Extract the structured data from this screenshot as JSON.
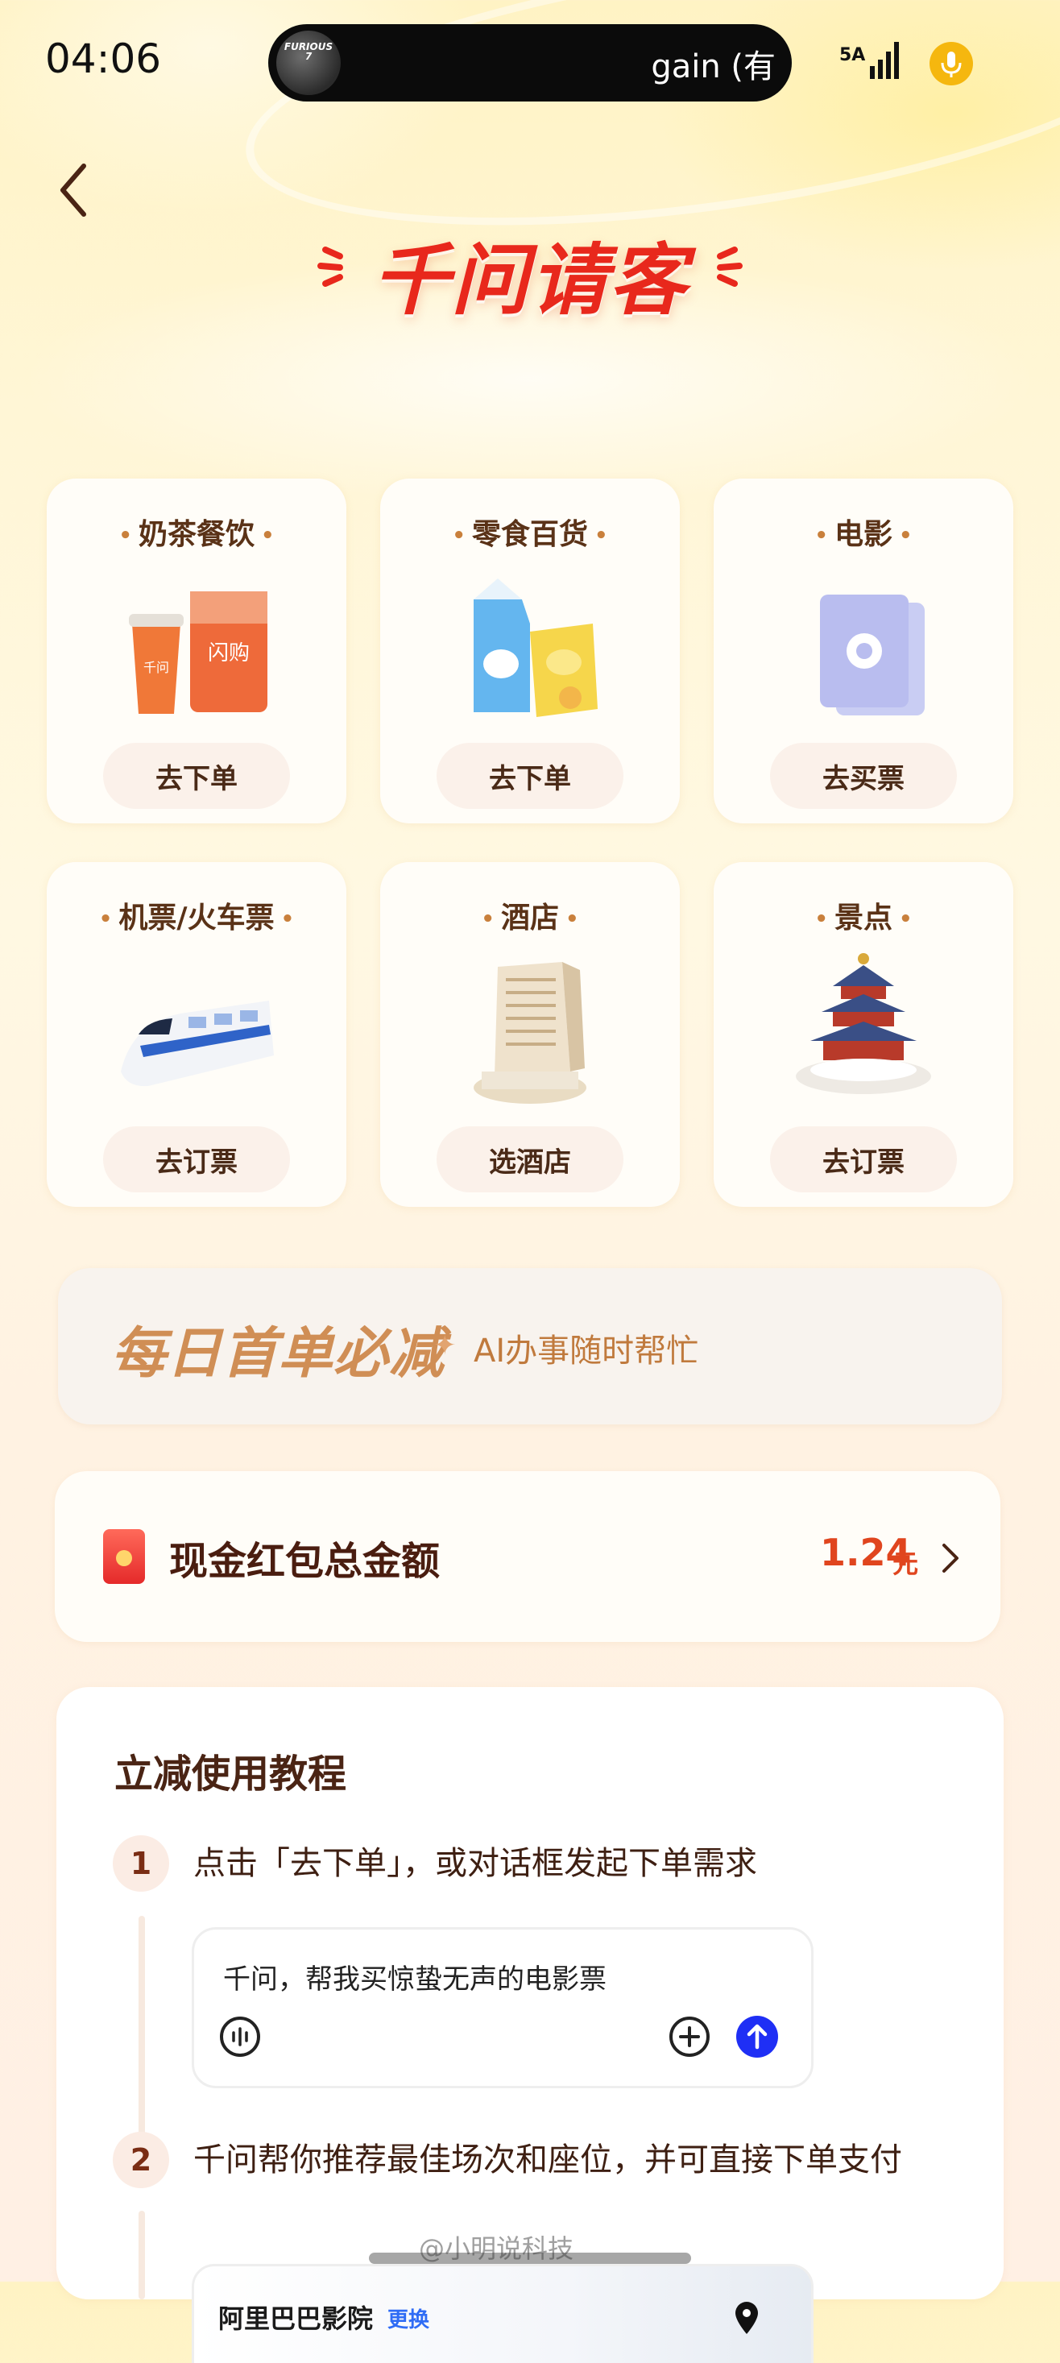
{
  "status_bar": {
    "time": "04:06",
    "island_thumb_text": "FURIOUS 7",
    "island_text": "gain (有",
    "signal_label": "5A",
    "mic_color": "#f5b70f"
  },
  "header": {
    "back_icon": "chevron-left-icon",
    "title": "千问请客",
    "title_color": "#e8281c"
  },
  "services": [
    {
      "title": "奶茶餐饮",
      "button": "去下单",
      "icon": "milk-tea-icon"
    },
    {
      "title": "零食百货",
      "button": "去下单",
      "icon": "snacks-icon"
    },
    {
      "title": "电影",
      "button": "去买票",
      "icon": "movie-ticket-icon"
    },
    {
      "title": "机票/火车票",
      "button": "去订票",
      "icon": "train-icon"
    },
    {
      "title": "酒店",
      "button": "选酒店",
      "icon": "hotel-icon"
    },
    {
      "title": "景点",
      "button": "去订票",
      "icon": "temple-icon"
    }
  ],
  "promo": {
    "main": "每日首单必减",
    "star": "✦",
    "sub": "AI办事随时帮忙"
  },
  "red_packet": {
    "label": "现金红包总金额",
    "amount": "1.24",
    "unit": "元",
    "accent": "#e0451e"
  },
  "tutorial": {
    "title": "立减使用教程",
    "steps": [
      {
        "num": "1",
        "text": "点击「去下单」，或对话框发起下单需求"
      },
      {
        "num": "2",
        "text": "千问帮你推荐最佳场次和座位，并可直接下单支付"
      }
    ],
    "chat_text": "千问，帮我买惊蛰无声的电影票",
    "cinema_name": "阿里巴巴影院",
    "cinema_change": "更换"
  },
  "watermark": "@小明说科技"
}
